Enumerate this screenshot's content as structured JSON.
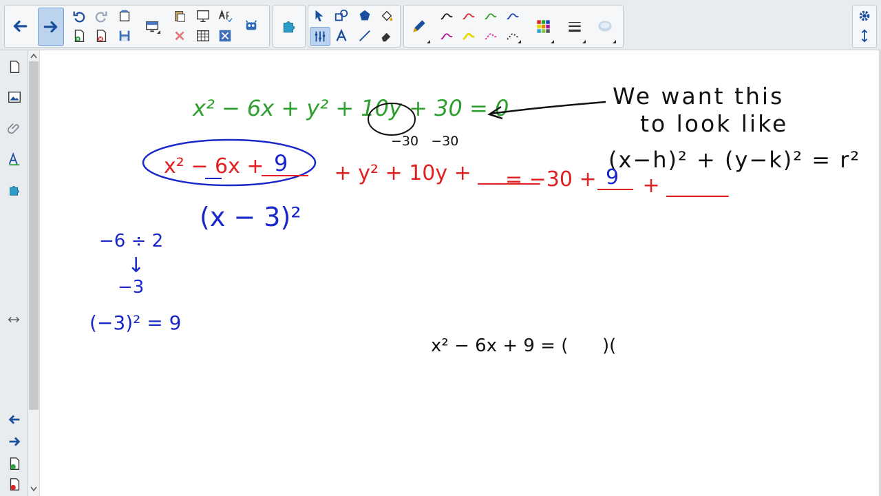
{
  "toolbar": {
    "navigation": [
      "back-arrow-icon",
      "forward-arrow-icon"
    ],
    "page_tools": [
      "undo-icon",
      "redo-icon",
      "clear-page-icon",
      "add-page-icon",
      "delete-page-icon",
      "save-icon",
      "screen-shade-icon",
      "paste-icon",
      "delete-icon",
      "full-screen-icon",
      "table-icon",
      "spell-check-icon",
      "close-icon",
      "monster-icon"
    ],
    "addons": [
      "puzzle-icon"
    ],
    "drawing_tools": [
      "select-icon",
      "shapes-icon",
      "regular-polygon-icon",
      "fill-icon",
      "lines-icon",
      "text-icon",
      "line-icon",
      "eraser-icon"
    ],
    "pen_colors": [
      "#1a1a1a",
      "#d62828",
      "#2aa02a",
      "#1f3fbf",
      "#b0149a",
      "#e6d800",
      "#e0329a",
      "#1a1a1a"
    ],
    "right_tools": [
      "settings-gear-icon",
      "move-toolbar-icon"
    ]
  },
  "sidebar": {
    "tabs": [
      "page-sorter-icon",
      "gallery-icon",
      "attachments-icon",
      "properties-icon",
      "addons-icon"
    ],
    "resize_handle": "resize-arrows-icon",
    "bottom": [
      "previous-page-icon",
      "next-page-icon",
      "add-page-icon",
      "delete-page-icon"
    ]
  },
  "colors": {
    "green_ink": "#2e9e2e",
    "red_ink": "#e02020",
    "blue_ink": "#1a27c9",
    "black_ink": "#111111"
  },
  "handwriting": {
    "original_equation": "x² − 6x + y² + 10y + 30 = 0",
    "subtract_row": "−30   −30",
    "note_line1": "We want this",
    "note_line2": "to look like",
    "target_form": "(x−h)² + (y−k)² = r²",
    "completed_left_a": "x² − 6x + ",
    "completed_nine": "9",
    "completed_rest": " + y² + 10y + ______",
    "completed_right": "= −30 + ",
    "completed_nine2": "9",
    "completed_tail": " + ______",
    "factored_square": "(x − 3)²",
    "half_step": "−6 ÷ 2",
    "arrow": "↓",
    "half_result": "−3",
    "square_step": "(−3)² = 9",
    "factor_attempt": "x² − 6x + 9 = (      )("
  }
}
